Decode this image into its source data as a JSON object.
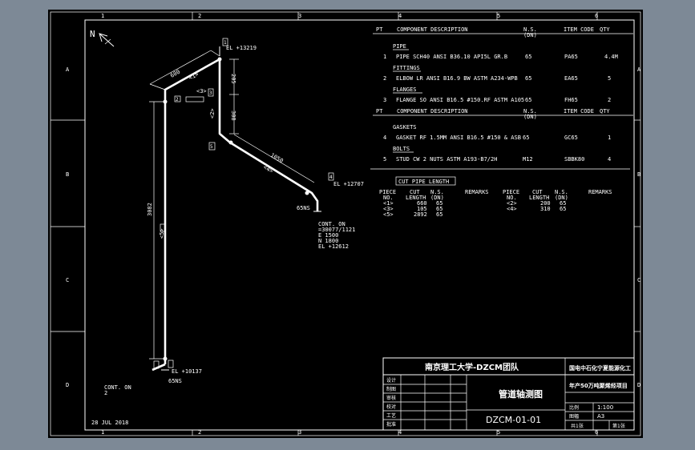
{
  "frame": {
    "columns": [
      "1",
      "2",
      "3",
      "4",
      "5",
      "6"
    ],
    "rows": [
      "A",
      "B",
      "C",
      "D"
    ],
    "date": "28 JUL 2018",
    "north": "N"
  },
  "bom": {
    "hdr_pt": "PT",
    "hdr_desc": "COMPONENT DESCRIPTION",
    "hdr_ns1": "N.S.",
    "hdr_ns2": "(DN)",
    "hdr_code": "ITEM CODE",
    "hdr_qty": "QTY",
    "sections": [
      {
        "title": "PIPE",
        "pt": "1",
        "desc": "PIPE SCH40 ANSI B36.10 API5L GR.B",
        "dn": "65",
        "code": "PA65",
        "qty": "4.4M"
      },
      {
        "title": "FITTINGS",
        "pt": "2",
        "desc": "ELBOW LR ANSI B16.9 BW ASTM A234-WPB",
        "dn": "65",
        "code": "EA65",
        "qty": "5"
      },
      {
        "title": "FLANGES",
        "pt": "3",
        "desc": "FLANGE SO ANSI B16.5 #150.RF ASTM A105",
        "dn": "65",
        "code": "FH65",
        "qty": "2"
      }
    ],
    "sections2": [
      {
        "title": "GASKETS",
        "pt": "4",
        "desc": "GASKET RF 1.5MM ANSI B16.5 #150 & ASB",
        "dn": "65",
        "code": "GC65",
        "qty": "1"
      },
      {
        "title": "BOLTS",
        "pt": "5",
        "desc": "STUD CW 2 NUTS ASTM A193-B7/2H",
        "dn": "M12",
        "code": "SBBK80",
        "qty": "4"
      }
    ]
  },
  "cut": {
    "title": "CUT PIPE LENGTH",
    "h_piece": "PIECE",
    "h_no": "NO.",
    "h_cut": "CUT",
    "h_length": "LENGTH",
    "h_ns": "N.S.",
    "h_dn": "(DN)",
    "h_remarks": "REMARKS",
    "left": [
      {
        "no": "<1>",
        "len": "660",
        "dn": "65"
      },
      {
        "no": "<3>",
        "len": "105",
        "dn": "65"
      },
      {
        "no": "<5>",
        "len": "2892",
        "dn": "65"
      }
    ],
    "right": [
      {
        "no": "<2>",
        "len": "200",
        "dn": "65"
      },
      {
        "no": "<4>",
        "len": "310",
        "dn": "65"
      }
    ]
  },
  "iso": {
    "el_top": "EL +13219",
    "el_mid": "EL +12707",
    "el_bot": "EL +10137",
    "dim_600": "600",
    "dim_205": "205",
    "dim_308": "308",
    "dim_1050": "1050",
    "dim_3082": "3082",
    "piece1": "<1>",
    "piece2": "<2>",
    "piece3": "<3>",
    "piece4": "<4>",
    "piece5": "<5>",
    "ns_mid": "65NS",
    "ns_bot": "65NS",
    "cont_on": "CONT. ON",
    "cont_ref": "=30077/1121",
    "cont_e": "E 1500",
    "cont_n": "N 1800",
    "cont_el": "EL +12612",
    "cont_on_bot": "CONT. ON",
    "cont_on_bot_ref": "2",
    "tag1": "1",
    "tag2": "2",
    "tag3": "3",
    "tag4": "4",
    "tag5": "5"
  },
  "title_block": {
    "org": "南京理工大学-DZCM团队",
    "project": "国电中石化宁夏能源化工",
    "project2": "年产50万吨聚烯烃项目",
    "drawing_title": "管道轴测图",
    "drawing_no": "DZCM-01-01",
    "roles": [
      "设计",
      "制图",
      "审核",
      "校对",
      "工艺",
      "批准"
    ],
    "scale_label": "比例",
    "scale": "1:100",
    "size_label": "图幅",
    "size": "A3",
    "sheet_label": "共1张",
    "sheet": "第1张"
  }
}
